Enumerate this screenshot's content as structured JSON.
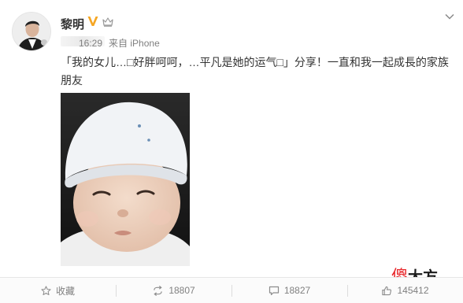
{
  "post": {
    "author": "黎明",
    "meta": {
      "time": "16:29",
      "source_prefix": "来自",
      "source": "iPhone"
    },
    "text": "「我的女儿…□好胖呵呵，…平凡是她的运气□」分享！一直和我一起成長的家族朋友"
  },
  "actions": {
    "favorite_label": "收藏",
    "repost_count": "18807",
    "comment_count": "18827",
    "like_count": "145412"
  },
  "watermark": {
    "red_char": "傻",
    "rest": "大方"
  },
  "colors": {
    "verified": "#f5a623",
    "accent_red": "#e8262a",
    "meta_gray": "#808080"
  },
  "icons": {
    "verified": "verified-v-icon",
    "crown": "crown-icon",
    "favorite": "star-icon",
    "repost": "repost-icon",
    "comment": "comment-icon",
    "like": "thumbs-up-icon",
    "menu": "chevron-down-icon"
  }
}
